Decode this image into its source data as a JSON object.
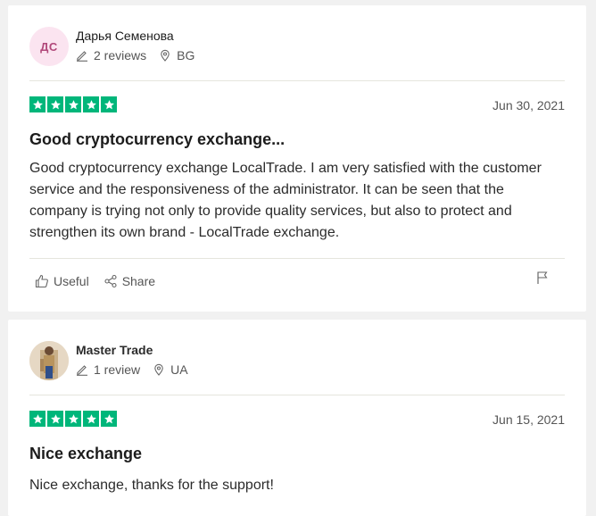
{
  "reviews": [
    {
      "avatar_initials": "ДС",
      "name": "Дарья Семенова",
      "review_count": "2 reviews",
      "country": "BG",
      "rating": 5,
      "date": "Jun 30, 2021",
      "title": "Good cryptocurrency exchange...",
      "body": "Good cryptocurrency exchange LocalTrade. I am very satisfied with the customer service and the responsiveness of the administrator. It can be seen that the company is trying not only to provide quality services, but also to protect and strengthen its own brand - LocalTrade exchange.",
      "useful_label": "Useful",
      "share_label": "Share"
    },
    {
      "name": "Master Trade",
      "review_count": "1 review",
      "country": "UA",
      "rating": 5,
      "date": "Jun 15, 2021",
      "title": "Nice exchange",
      "body": "Nice exchange, thanks for the support!"
    }
  ],
  "colors": {
    "star_green": "#00b67a",
    "avatar_bg": "#fbe4f0",
    "avatar_text": "#b1487a"
  },
  "icons": [
    "pencil-icon",
    "location-pin-icon",
    "star-icon",
    "thumbs-up-icon",
    "share-icon",
    "flag-icon"
  ]
}
